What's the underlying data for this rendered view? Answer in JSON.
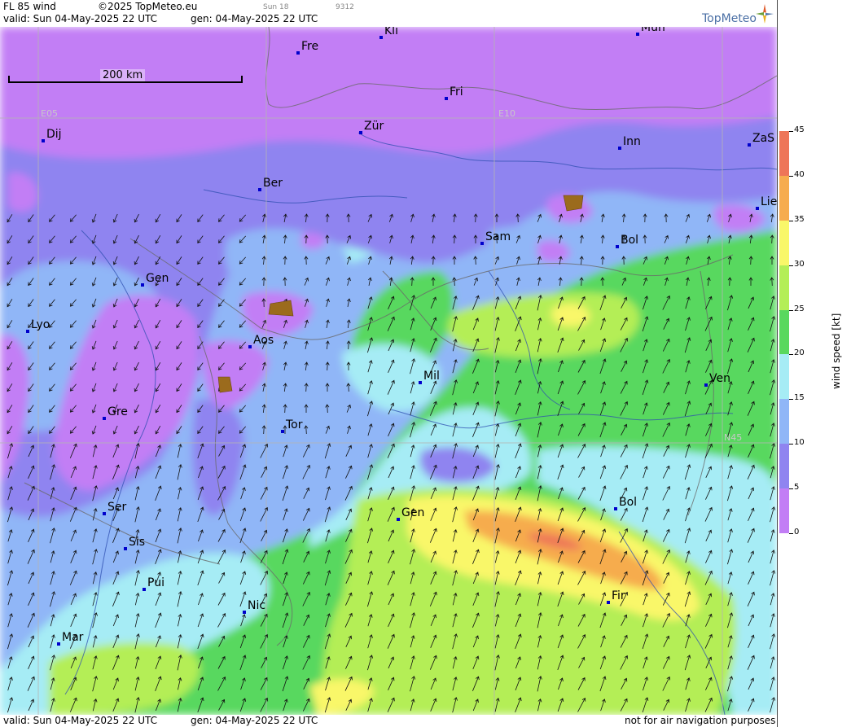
{
  "header": {
    "product": "FL 85 wind",
    "copyright": "©2025 TopMeteo.eu",
    "sun_label": "Sun 18",
    "code": "9312",
    "valid": "valid:  Sun  04-May-2025  22 UTC",
    "generated": "gen: 04-May-2025 22 UTC",
    "brand": "TopMeteo"
  },
  "map": {
    "scale_label": "200 km",
    "grid_labels": {
      "lon_left": "E05",
      "lon_right": "E10",
      "lat": "N45"
    },
    "cities": [
      {
        "name": "Kli"
      },
      {
        "name": "Mün"
      },
      {
        "name": "Fre"
      },
      {
        "name": "Fri"
      },
      {
        "name": "Dij"
      },
      {
        "name": "Zür"
      },
      {
        "name": "Inn"
      },
      {
        "name": "ZaS"
      },
      {
        "name": "Ber"
      },
      {
        "name": "Lie"
      },
      {
        "name": "Sam"
      },
      {
        "name": "Bol"
      },
      {
        "name": "Gen"
      },
      {
        "name": "Lyo"
      },
      {
        "name": "Aos"
      },
      {
        "name": "Mil"
      },
      {
        "name": "Ven"
      },
      {
        "name": "Gre"
      },
      {
        "name": "Tor"
      },
      {
        "name": "Ser"
      },
      {
        "name": "Gen"
      },
      {
        "name": "Bol"
      },
      {
        "name": "Sis"
      },
      {
        "name": "Pui"
      },
      {
        "name": "Nic"
      },
      {
        "name": "Fir"
      },
      {
        "name": "Mar"
      }
    ]
  },
  "footer": {
    "valid": "valid:  Sun  04-May-2025  22 UTC",
    "generated": "gen: 04-May-2025 22 UTC",
    "disclaimer": "not for air navigation purposes"
  },
  "legend": {
    "title": "wind speed [kt]",
    "ticks": [
      "45",
      "40",
      "35",
      "30",
      "25",
      "20",
      "15",
      "10",
      "5",
      "0"
    ],
    "colors": {
      "0-5": "#c27ef5",
      "5-10": "#8f84f0",
      "10-15": "#90b6f7",
      "15-20": "#a6ecf5",
      "20-25": "#59d85e",
      "25-30": "#b4ee57",
      "30-35": "#f9f769",
      "35-40": "#f6ac4e",
      "40-45": "#ee7558"
    }
  }
}
